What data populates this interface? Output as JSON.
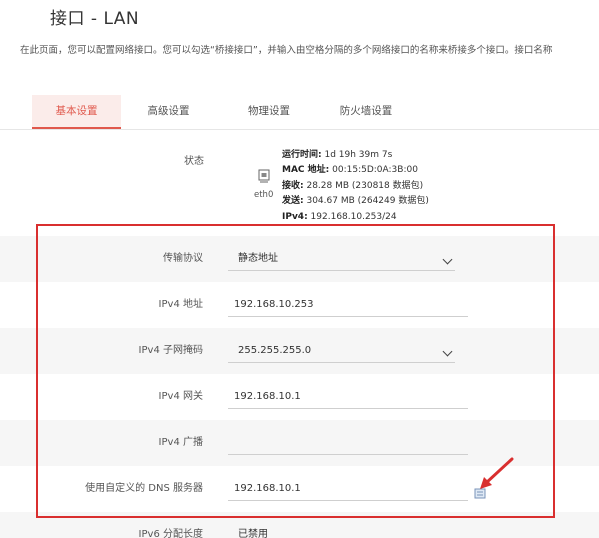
{
  "page": {
    "title": "接口 - LAN",
    "description": "在此页面，您可以配置网络接口。您可以勾选“桥接接口”，并输入由空格分隔的多个网络接口的名称来桥接多个接口。接口名称"
  },
  "tabs": [
    {
      "label": "基本设置",
      "active": true
    },
    {
      "label": "高级设置",
      "active": false
    },
    {
      "label": "物理设置",
      "active": false
    },
    {
      "label": "防火墙设置",
      "active": false
    }
  ],
  "status": {
    "label": "状态",
    "device": "eth0",
    "device_icon": "ethernet-port-icon",
    "lines": [
      {
        "key": "运行时间:",
        "value": " 1d 19h 39m 7s"
      },
      {
        "key": "MAC 地址:",
        "value": " 00:15:5D:0A:3B:00"
      },
      {
        "key": "接收:",
        "value": " 28.28 MB (230818 数据包)"
      },
      {
        "key": "发送:",
        "value": " 304.67 MB (264249 数据包)"
      },
      {
        "key": "IPv4:",
        "value": " 192.168.10.253/24"
      }
    ]
  },
  "fields": {
    "protocol": {
      "label": "传输协议",
      "value": "静态地址"
    },
    "ipv4_address": {
      "label": "IPv4 地址",
      "value": "192.168.10.253"
    },
    "ipv4_netmask": {
      "label": "IPv4 子网掩码",
      "value": "255.255.255.0"
    },
    "ipv4_gateway": {
      "label": "IPv4 网关",
      "value": "192.168.10.1"
    },
    "ipv4_broadcast": {
      "label": "IPv4 广播",
      "value": ""
    },
    "dns": {
      "label": "使用自定义的 DNS 服务器",
      "value": "192.168.10.1",
      "add_icon": "add-entry-icon"
    },
    "ipv6_assign": {
      "label": "IPv6 分配长度",
      "value": "已禁用"
    }
  },
  "colors": {
    "accent": "#e0584c",
    "tab_active_bg": "#fbecea",
    "highlight_box": "#d92f2f",
    "row_shade": "#f6f6f6"
  }
}
